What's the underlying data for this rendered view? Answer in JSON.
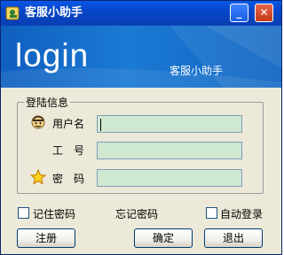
{
  "window": {
    "title": "客服小助手",
    "minimize_glyph": "_",
    "close_glyph": "✕"
  },
  "banner": {
    "heading": "login",
    "subtitle": "客服小助手"
  },
  "form": {
    "group_title": "登陆信息",
    "username_label": "用户名",
    "job_no_label": "工　号",
    "password_label": "密　码",
    "username_value": "",
    "job_no_value": "",
    "password_value": ""
  },
  "options": {
    "remember_password": "记住密码",
    "forgot_password": "忘记密码",
    "auto_login": "自动登录",
    "remember_checked": false,
    "auto_login_checked": false
  },
  "buttons": {
    "register": "注册",
    "confirm": "确定",
    "exit": "退出"
  },
  "colors": {
    "title_bar": "#0646c8",
    "banner": "#1b7ad3",
    "field_bg": "#cfe8d0",
    "window_bg": "#ece9d8"
  }
}
